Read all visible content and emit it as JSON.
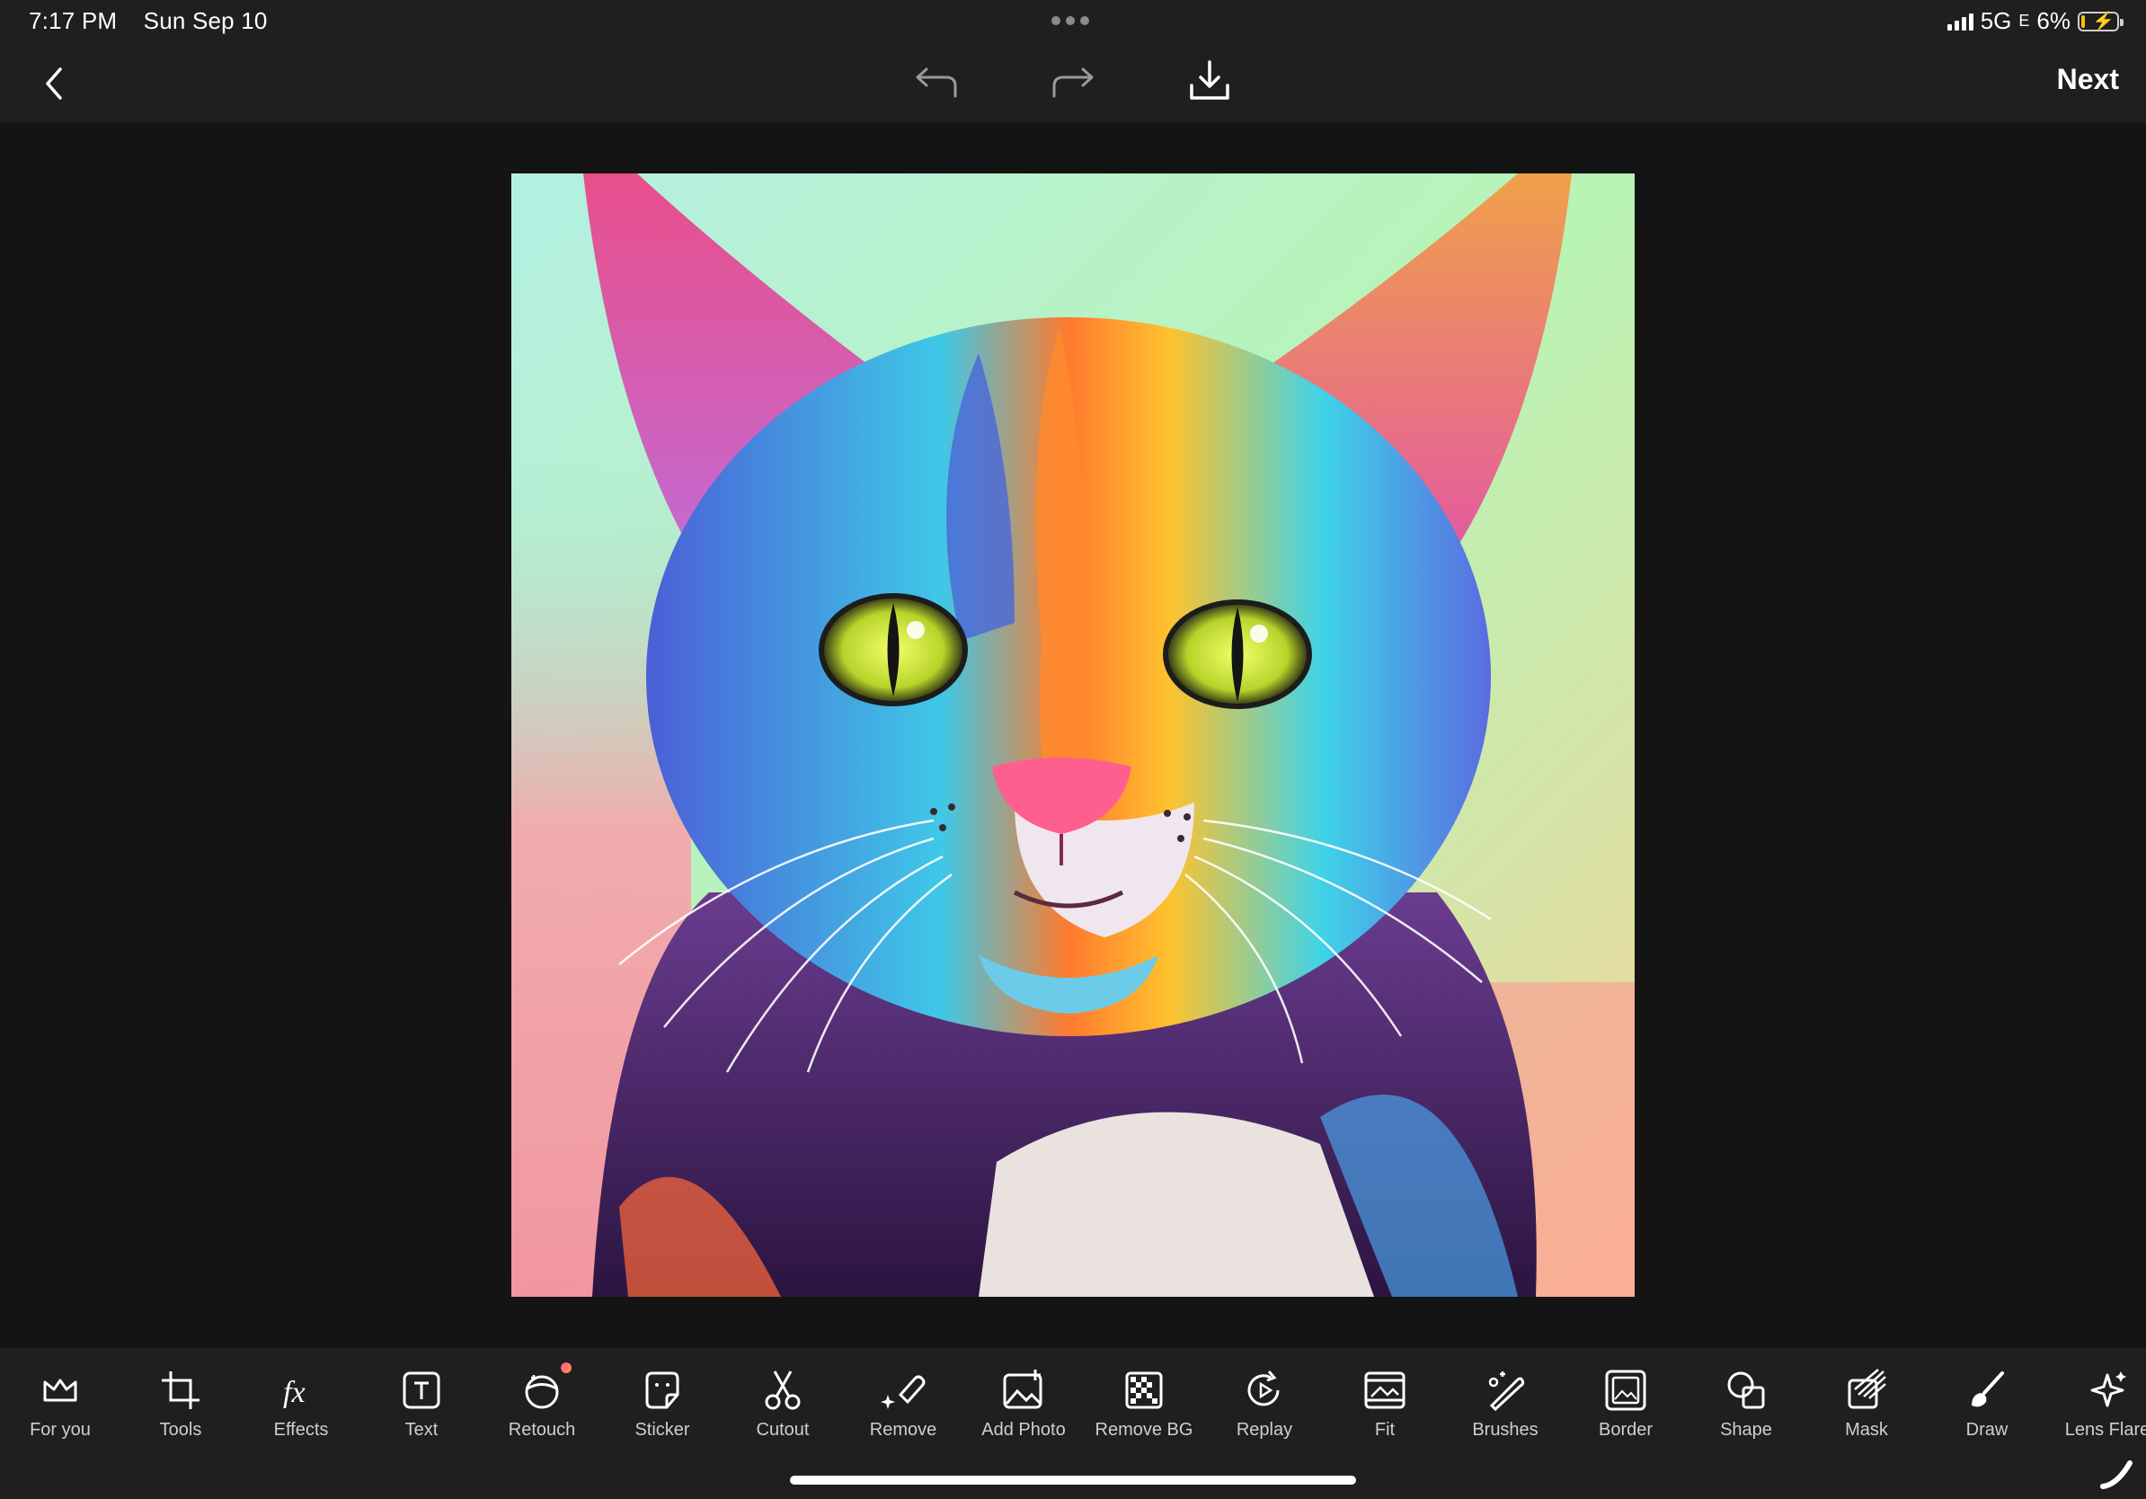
{
  "status_bar": {
    "time": "7:17 PM",
    "date": "Sun Sep 10",
    "network": "5G",
    "network_sub": "E",
    "battery": "6%"
  },
  "header": {
    "back_icon": "chevron-left-icon",
    "undo_icon": "undo-icon",
    "redo_icon": "redo-icon",
    "download_icon": "download-icon",
    "next_label": "Next"
  },
  "canvas": {
    "image_subject": "colorful rainbow cat illustration"
  },
  "tools": [
    {
      "label": "For you",
      "icon": "crown-icon"
    },
    {
      "label": "Tools",
      "icon": "crop-icon"
    },
    {
      "label": "Effects",
      "icon": "fx-icon"
    },
    {
      "label": "Text",
      "icon": "text-icon"
    },
    {
      "label": "Retouch",
      "icon": "retouch-face-icon",
      "badge": true
    },
    {
      "label": "Sticker",
      "icon": "sticker-icon"
    },
    {
      "label": "Cutout",
      "icon": "scissors-icon"
    },
    {
      "label": "Remove",
      "icon": "eraser-icon"
    },
    {
      "label": "Add Photo",
      "icon": "add-photo-icon"
    },
    {
      "label": "Remove BG",
      "icon": "remove-bg-icon"
    },
    {
      "label": "Replay",
      "icon": "replay-icon"
    },
    {
      "label": "Fit",
      "icon": "fit-icon"
    },
    {
      "label": "Brushes",
      "icon": "magic-wand-icon"
    },
    {
      "label": "Border",
      "icon": "border-icon"
    },
    {
      "label": "Shape",
      "icon": "shape-icon"
    },
    {
      "label": "Mask",
      "icon": "mask-icon"
    },
    {
      "label": "Draw",
      "icon": "brush-icon"
    },
    {
      "label": "Lens Flare",
      "icon": "lens-flare-icon"
    }
  ],
  "colors": {
    "background": "#141414",
    "bar": "#1f1f1f",
    "text": "#ffffff",
    "muted": "#cfcfcf",
    "accent_badge": "#ff4fa0"
  }
}
